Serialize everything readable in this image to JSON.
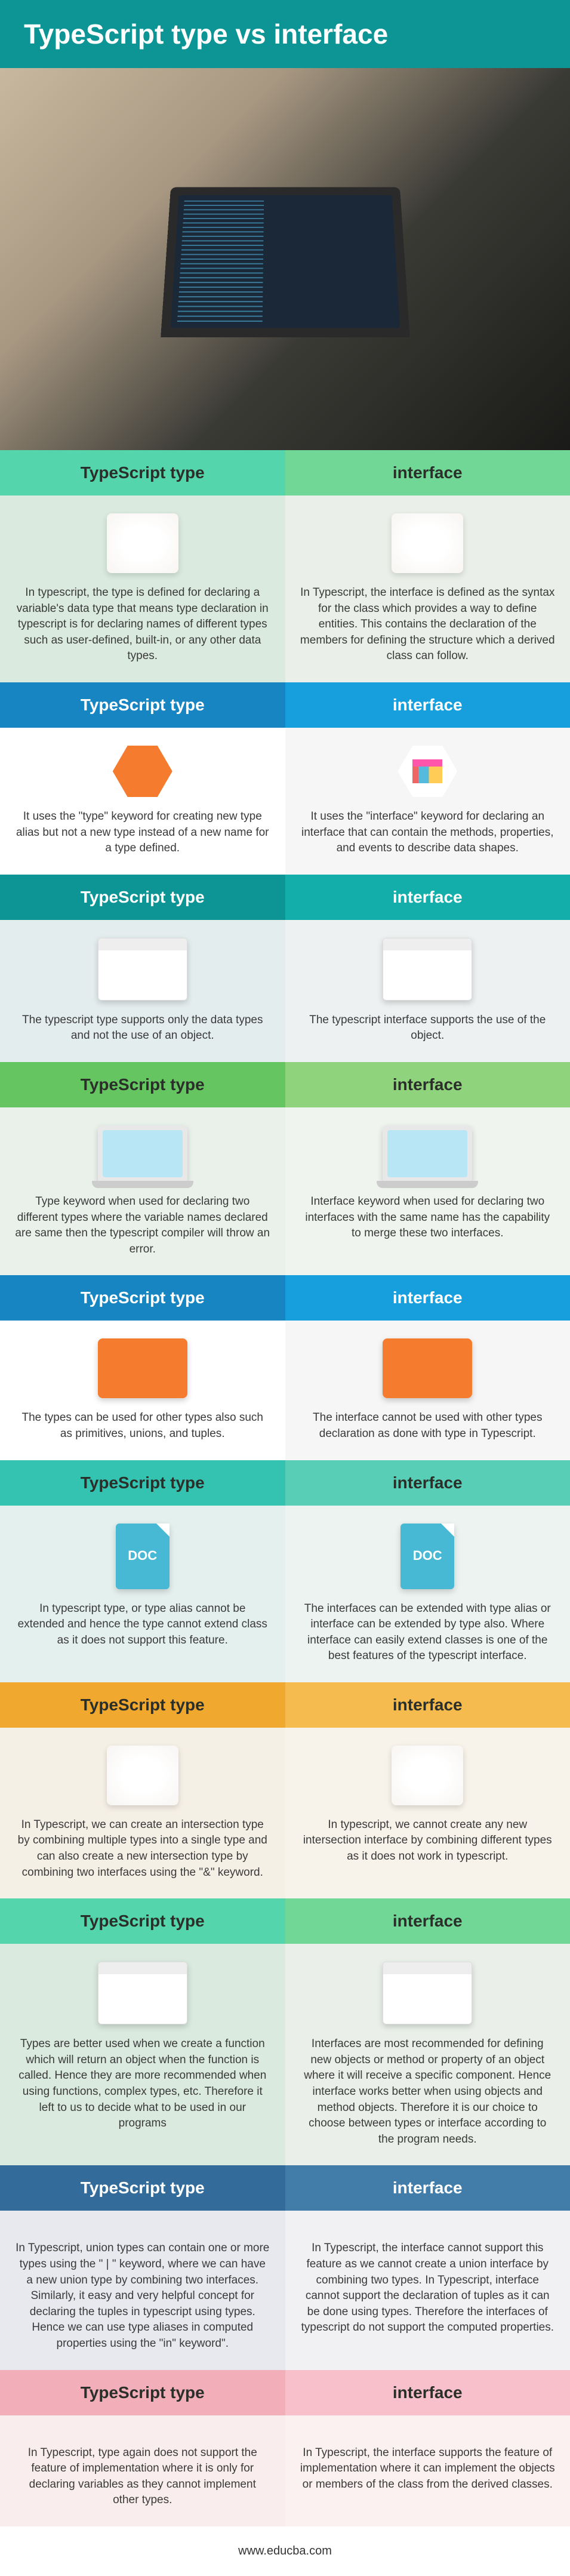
{
  "title": "TypeScript type vs interface",
  "footer": "www.educba.com",
  "headers": {
    "left": "TypeScript type",
    "right": "interface"
  },
  "icons": {
    "code": "</>",
    "doc": "DOC"
  },
  "rows": [
    {
      "header_bg": [
        "bg-green-a",
        "bg-green-b"
      ],
      "content_bg": [
        "bg-content-greenish-a",
        "bg-content-greenish-b"
      ],
      "icon": "desk",
      "left": "In typescript, the type is defined for declaring a variable's data type that means type declaration in typescript is for declaring names of different types such as user-defined, built-in, or any other data types.",
      "right": "In Typescript, the interface is defined as the syntax for the class which provides a way to define entities. This contains the declaration of the members for defining the structure which a derived class can follow."
    },
    {
      "header_bg": [
        "bg-blue-a",
        "bg-blue-b"
      ],
      "content_bg": [
        "bg-content-white-a",
        "bg-content-white-b"
      ],
      "icon": "hex-orange",
      "icon_right": "hex-gray",
      "left": "It uses the \"type\" keyword for creating new type alias but not a new type instead of a new name for a type defined.",
      "right": "It uses the \"interface\" keyword for declaring an interface that can contain the methods, properties, and events to describe data shapes."
    },
    {
      "header_bg": [
        "bg-teal-a",
        "bg-teal-b"
      ],
      "content_bg": [
        "bg-content-tealish-a",
        "bg-content-tealish-b"
      ],
      "icon": "browser",
      "left": "The typescript type supports only the data types and not the use of an object.",
      "right": "The typescript interface supports the use of the object."
    },
    {
      "header_bg": [
        "bg-lime-a",
        "bg-lime-b"
      ],
      "content_bg": [
        "bg-content-lime-a",
        "bg-content-lime-b"
      ],
      "icon": "laptop-mini",
      "left": "Type keyword when used for declaring two different types where the variable names declared are same then the typescript compiler will throw an error.",
      "right": "Interface keyword when used for declaring two interfaces with the same name has the capability to merge these two interfaces."
    },
    {
      "header_bg": [
        "bg-blue-a",
        "bg-blue-b"
      ],
      "content_bg": [
        "bg-content-white-a",
        "bg-content-white-b"
      ],
      "icon": "laptop-orange",
      "left": "The types can be used for other types also such as primitives, unions, and tuples.",
      "right": "The interface cannot be used with other types declaration as done with type in Typescript."
    },
    {
      "header_bg": [
        "bg-min-a",
        "bg-min-b"
      ],
      "content_bg": [
        "bg-content-min-a",
        "bg-content-min-b"
      ],
      "icon": "doc",
      "left": "In typescript type, or type alias cannot be extended and hence the type cannot extend class as it does not support this feature.",
      "right": "The interfaces can be extended with type alias or interface can be extended by type also. Where interface can easily extend classes is one of the best features of the typescript interface."
    },
    {
      "header_bg": [
        "bg-orange-a",
        "bg-orange-b"
      ],
      "content_bg": [
        "bg-content-orange-a",
        "bg-content-orange-b"
      ],
      "icon": "desk",
      "left": "In Typescript, we can create an intersection type by combining multiple types into a single type and can also create a new intersection type by combining two interfaces using the \"&\" keyword.",
      "right": "In typescript, we cannot create any new intersection interface by combining different types as it does not work in typescript."
    },
    {
      "header_bg": [
        "bg-green-a",
        "bg-green-b"
      ],
      "content_bg": [
        "bg-content-greenish-a",
        "bg-content-greenish-b"
      ],
      "icon": "browser",
      "left": "Types are better used when we create a function which will return an object when the function is called. Hence they are more recommended when using functions, complex types, etc. Therefore it left to us to decide what to be used in our programs",
      "right": "Interfaces are most recommended for defining new objects or method or property of an object where it will receive a specific component. Hence interface works better when using objects and method objects. Therefore it is our choice to choose between types or interface according to the program needs."
    },
    {
      "header_bg": [
        "bg-deepblue-a",
        "bg-deepblue-b"
      ],
      "content_bg": [
        "bg-content-steel-a",
        "bg-content-steel-b"
      ],
      "icon": "code-dark",
      "left": "In Typescript, union types can contain one or more types using the \" | \" keyword, where we can have a new union type by combining two interfaces. Similarly, it easy and very helpful concept for declaring the tuples in typescript using types. Hence we can use type aliases in computed properties using the \"in\" keyword\".",
      "right": "In Typescript, the interface cannot support this feature as we cannot create a union interface by combining two types. In Typescript, interface cannot support the declaration of tuples as it can be done using types. Therefore the interfaces of typescript do not support the computed properties."
    },
    {
      "header_bg": [
        "bg-pink-a",
        "bg-pink-b"
      ],
      "content_bg": [
        "bg-content-pink-a",
        "bg-content-pink-b"
      ],
      "icon": "code-dark",
      "left": "In Typescript, type again does not support the feature of implementation where it is only for declaring variables as they cannot implement other types.",
      "right": "In Typescript, the interface supports the feature of implementation where it can implement the objects or members of the class from the derived classes."
    }
  ]
}
